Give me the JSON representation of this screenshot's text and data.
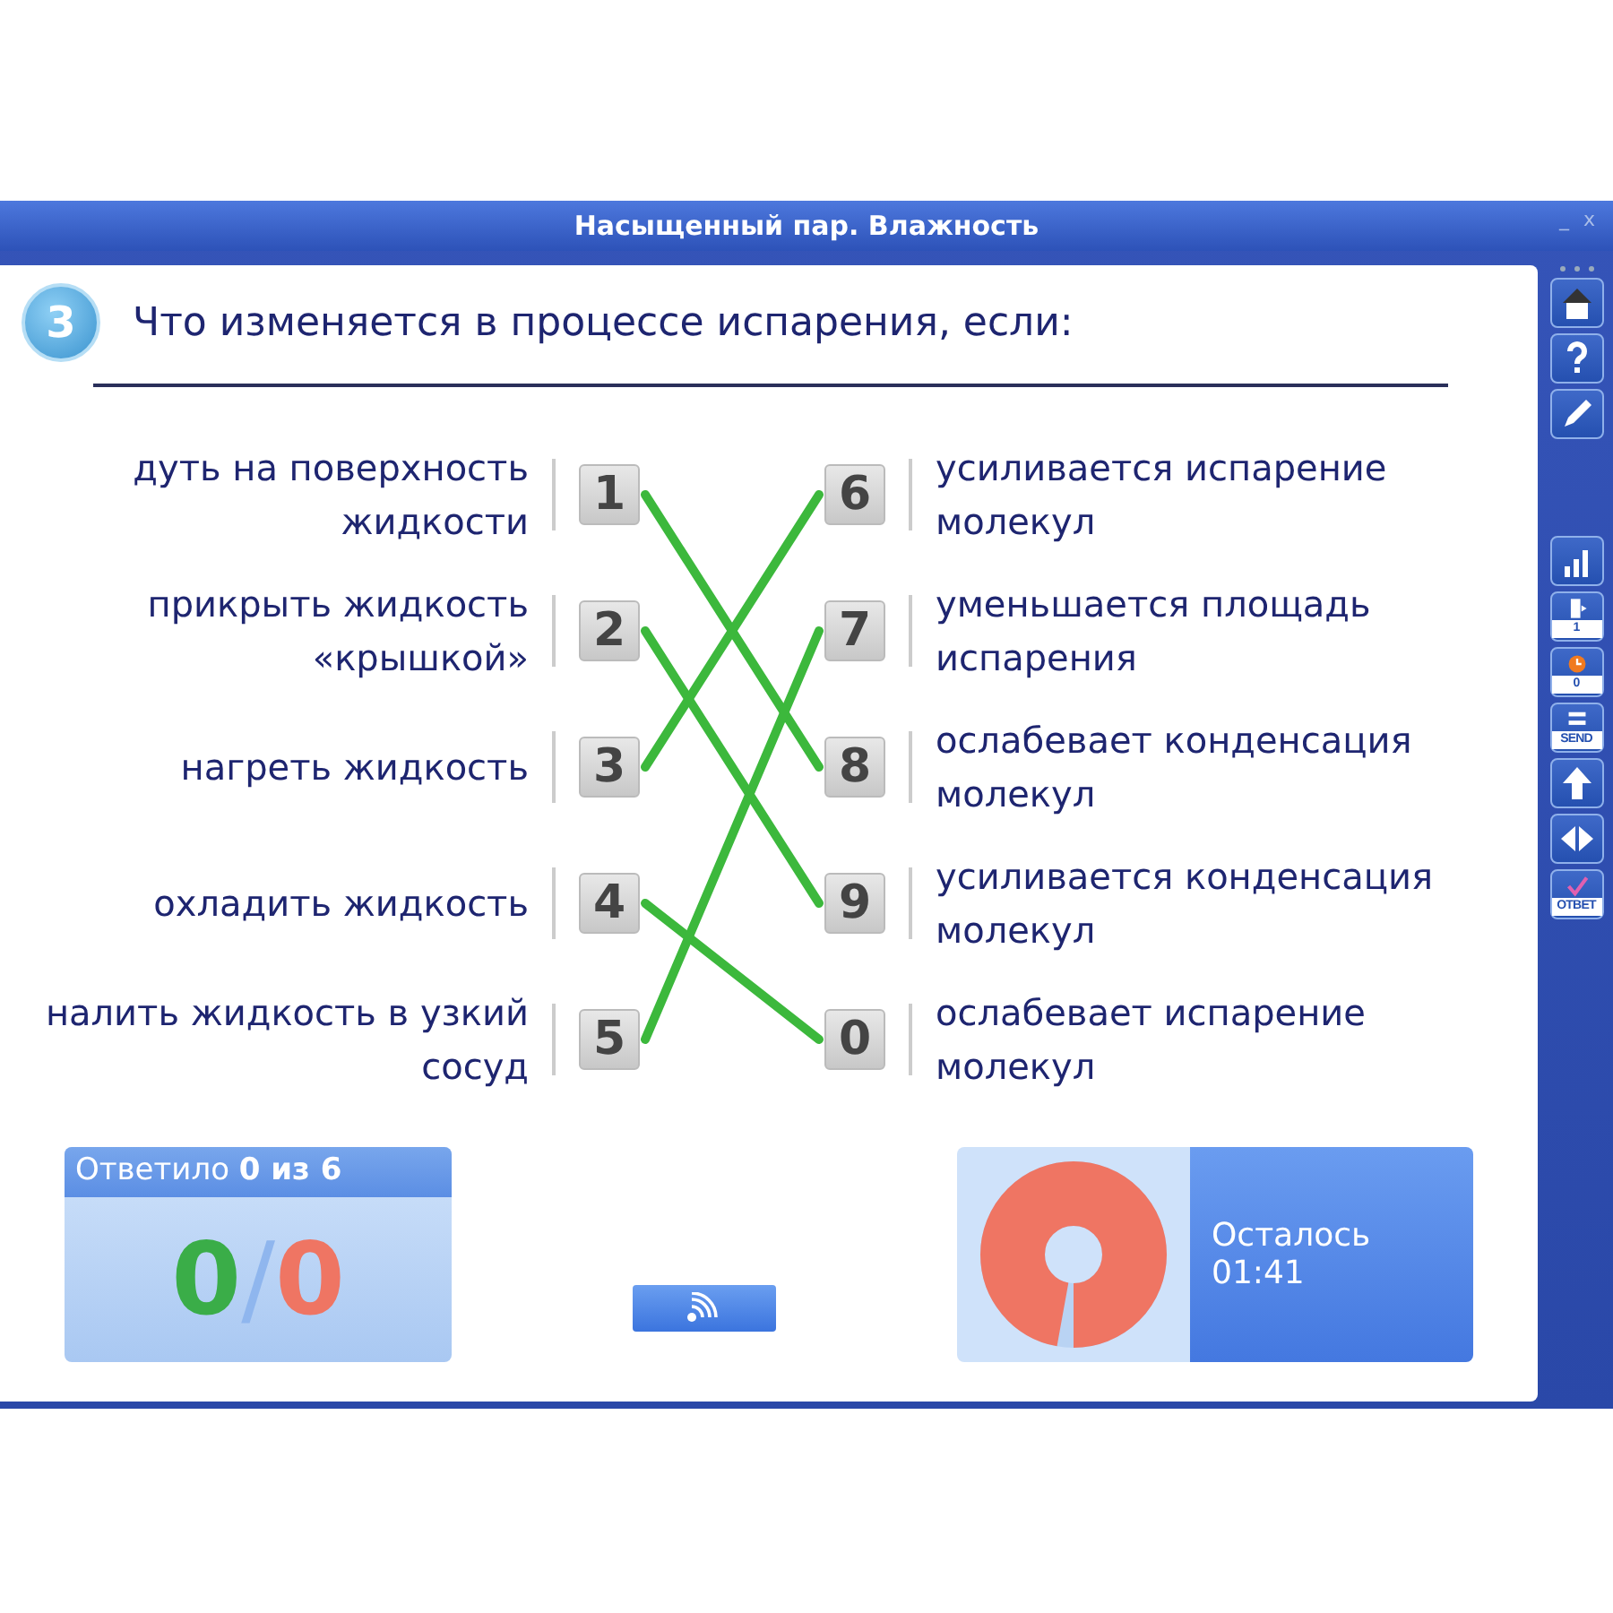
{
  "window": {
    "title": "Насыщенный пар. Влажность",
    "controls": [
      "_",
      "x"
    ]
  },
  "question": {
    "number": "3",
    "text": "Что изменяется в процессе испарения, если:"
  },
  "left": [
    {
      "text": "дуть на поверхность жидкости",
      "number": "1",
      "connected": true
    },
    {
      "text": "прикрыть жидкость «крышкой»",
      "number": "2",
      "connected": true
    },
    {
      "text": "нагреть жидкость",
      "number": "3",
      "connected": true
    },
    {
      "text": "охладить жидкость",
      "number": "4",
      "connected": true
    },
    {
      "text": "налить жидкость в узкий сосуд",
      "number": "5",
      "connected": true
    }
  ],
  "right": [
    {
      "text": "усиливается испарение молекул",
      "number": "6"
    },
    {
      "text": "уменьшается площадь испарения",
      "number": "7"
    },
    {
      "text": "ослабевает конденсация молекул",
      "number": "8"
    },
    {
      "text": "усиливается конденсация молекул",
      "number": "9"
    },
    {
      "text": "ослабевает испарение молекул",
      "number": "0"
    }
  ],
  "score": {
    "header": "Ответило **0 из 6**",
    "correct": "0",
    "separator": "/",
    "wrong": "0"
  },
  "timer": {
    "label": "Осталось",
    "time": "01:41",
    "level": 0.97
  },
  "toolbar": [
    {
      "kind": "home"
    },
    {
      "kind": "help"
    },
    {
      "kind": "pencil"
    },
    {
      "kind": "chart"
    },
    {
      "kind": "next",
      "label": "1"
    },
    {
      "kind": "clock",
      "label": "0"
    },
    {
      "kind": "send",
      "label": "SEND"
    },
    {
      "kind": "up"
    },
    {
      "kind": "arrows"
    },
    {
      "kind": "answer",
      "label": "ОТВЕТ"
    }
  ]
}
